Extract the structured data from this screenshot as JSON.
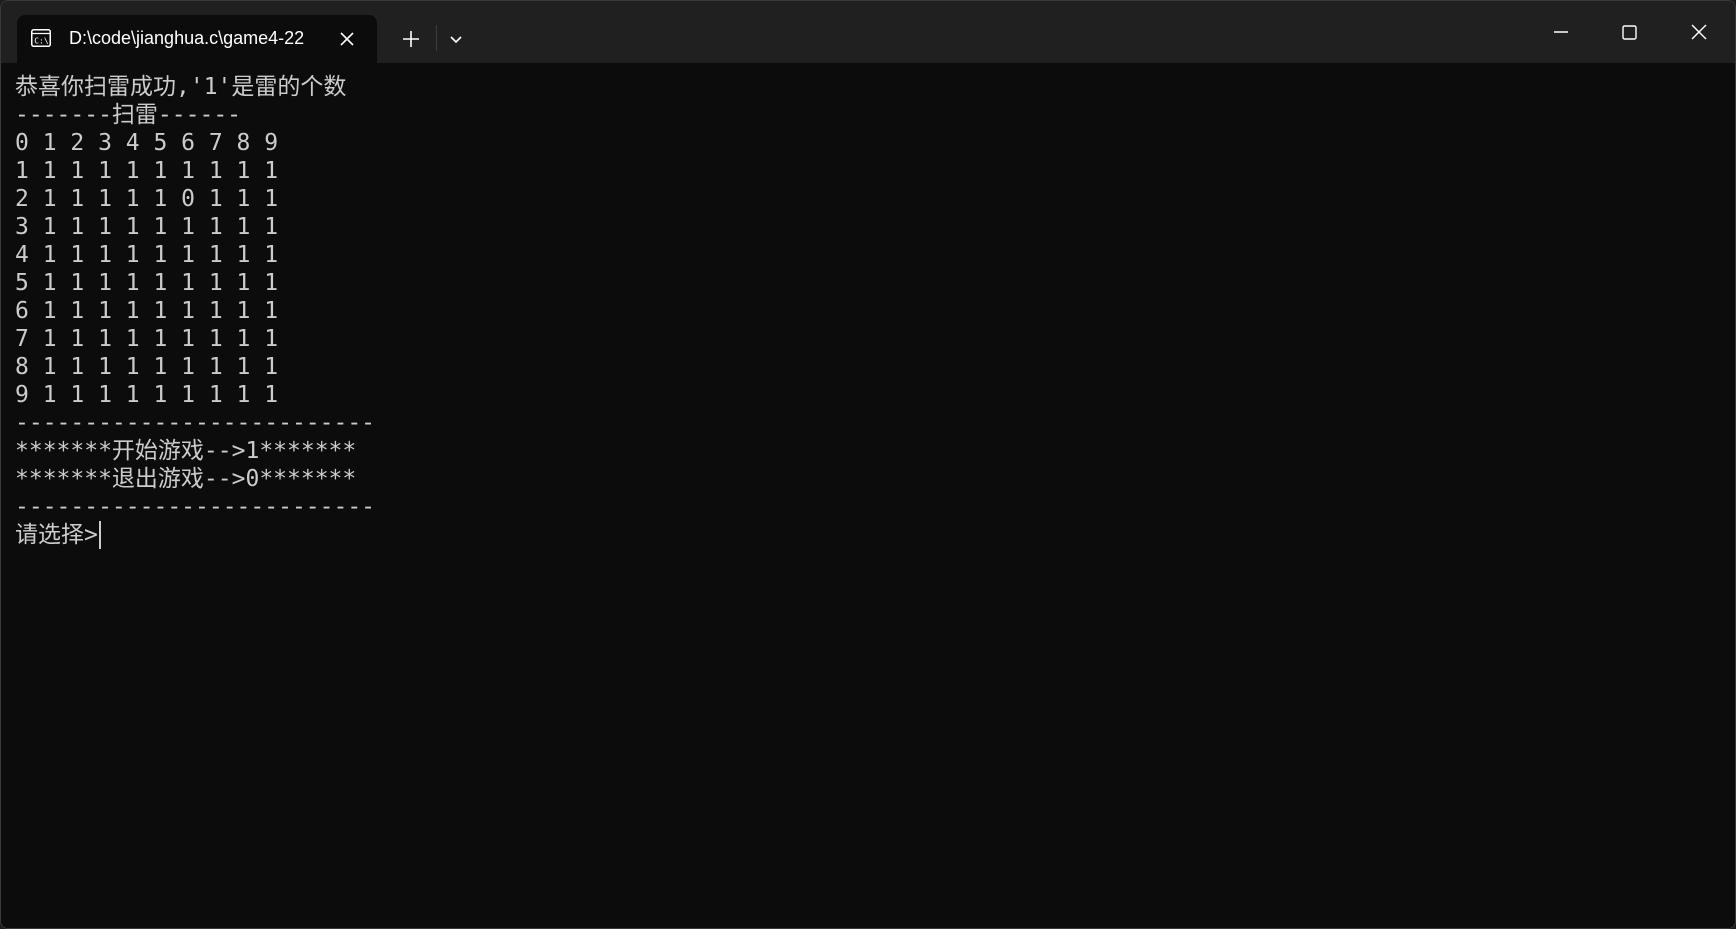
{
  "window": {
    "tab_title": "D:\\code\\jianghua.c\\game4-22",
    "tab_icon": "console-icon",
    "colors": {
      "background": "#0c0c0c",
      "titlebar": "#202020",
      "text": "#cccccc"
    }
  },
  "terminal": {
    "lines": [
      "恭喜你扫雷成功,'1'是雷的个数",
      "-------扫雷------",
      "0 1 2 3 4 5 6 7 8 9",
      "1 1 1 1 1 1 1 1 1 1",
      "2 1 1 1 1 1 0 1 1 1",
      "3 1 1 1 1 1 1 1 1 1",
      "4 1 1 1 1 1 1 1 1 1",
      "5 1 1 1 1 1 1 1 1 1",
      "6 1 1 1 1 1 1 1 1 1",
      "7 1 1 1 1 1 1 1 1 1",
      "8 1 1 1 1 1 1 1 1 1",
      "9 1 1 1 1 1 1 1 1 1",
      "--------------------------",
      "*******开始游戏-->1*******",
      "*******退出游戏-->0*******",
      "--------------------------",
      "请选择>"
    ]
  }
}
